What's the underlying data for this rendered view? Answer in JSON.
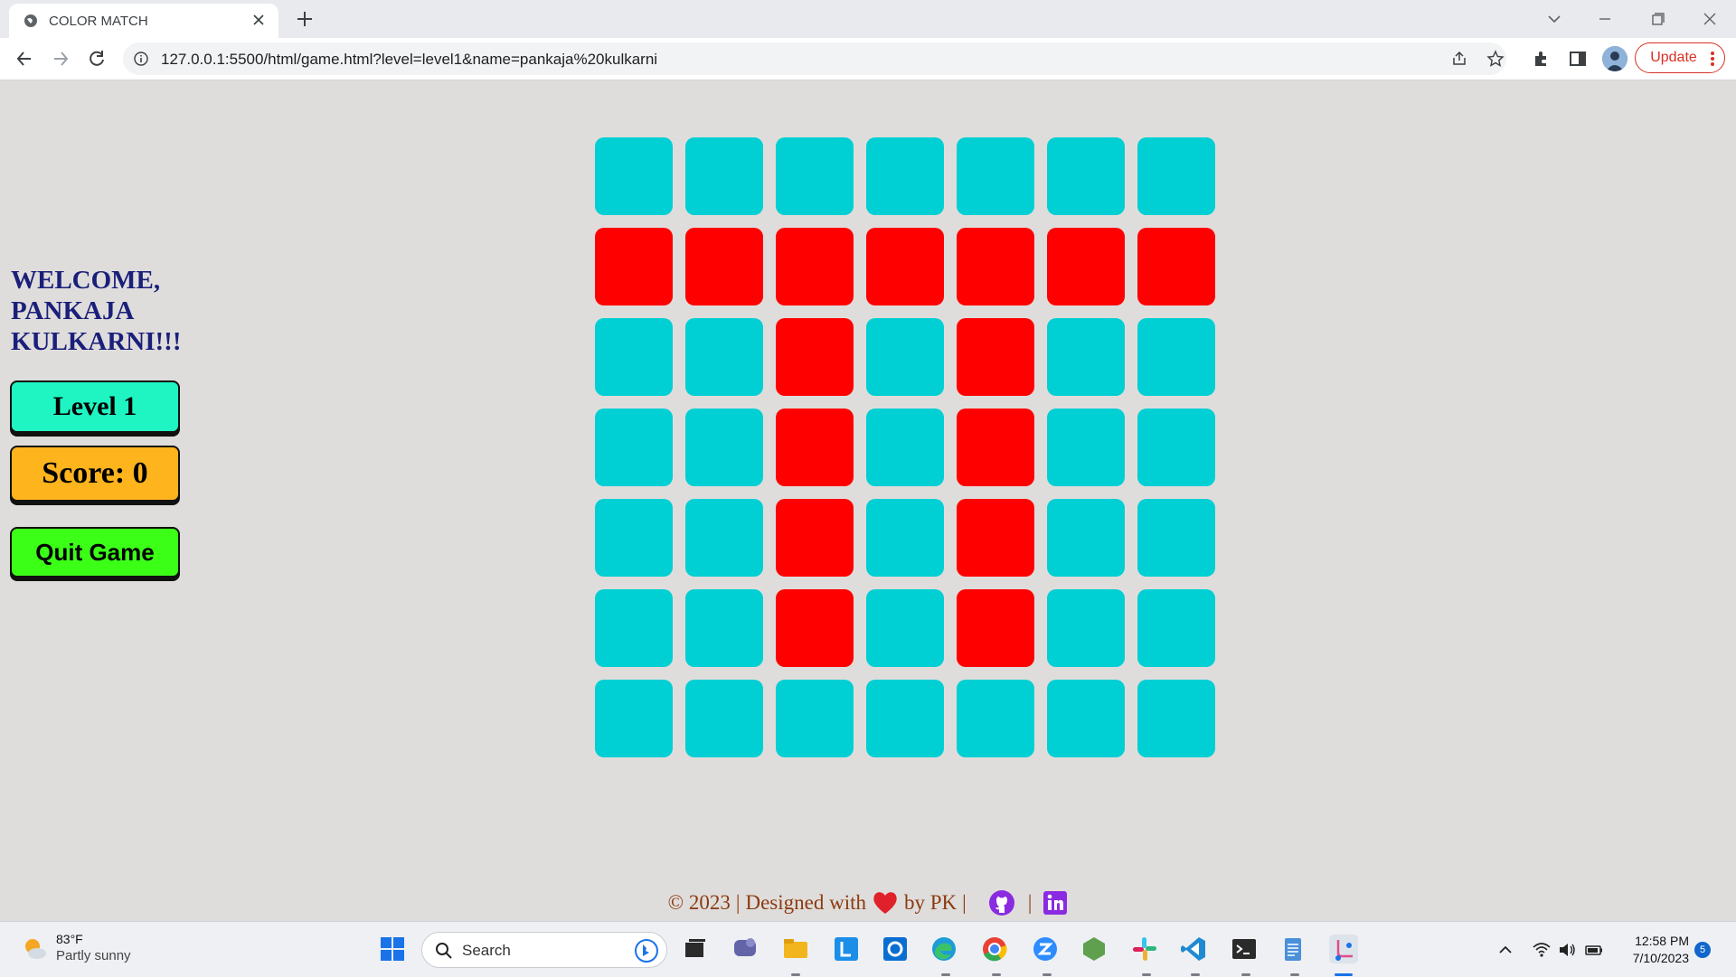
{
  "browser": {
    "tab_title": "COLOR MATCH",
    "url": "127.0.0.1:5500/html/game.html?level=level1&name=pankaja%20kulkarni",
    "update_label": "Update"
  },
  "game": {
    "welcome": "WELCOME, PANKAJA KULKARNI!!!",
    "level_label": "Level 1",
    "score_label": "Score: 0",
    "quit_label": "Quit Game",
    "colors": {
      "cyan": "#00cfd4",
      "red": "#ff0000"
    },
    "board": [
      [
        "c",
        "c",
        "c",
        "c",
        "c",
        "c",
        "c"
      ],
      [
        "r",
        "r",
        "r",
        "r",
        "r",
        "r",
        "r"
      ],
      [
        "c",
        "c",
        "r",
        "c",
        "r",
        "c",
        "c"
      ],
      [
        "c",
        "c",
        "r",
        "c",
        "r",
        "c",
        "c"
      ],
      [
        "c",
        "c",
        "r",
        "c",
        "r",
        "c",
        "c"
      ],
      [
        "c",
        "c",
        "r",
        "c",
        "r",
        "c",
        "c"
      ],
      [
        "c",
        "c",
        "c",
        "c",
        "c",
        "c",
        "c"
      ]
    ]
  },
  "footer": {
    "prefix": "© 2023",
    "designed": "Designed with",
    "by": "by PK",
    "icons": [
      "heart-icon",
      "github-icon",
      "linkedin-icon"
    ]
  },
  "taskbar": {
    "weather_temp": "83°F",
    "weather_desc": "Partly sunny",
    "search_label": "Search",
    "time": "12:58 PM",
    "date": "7/10/2023",
    "notification_count": "5"
  }
}
